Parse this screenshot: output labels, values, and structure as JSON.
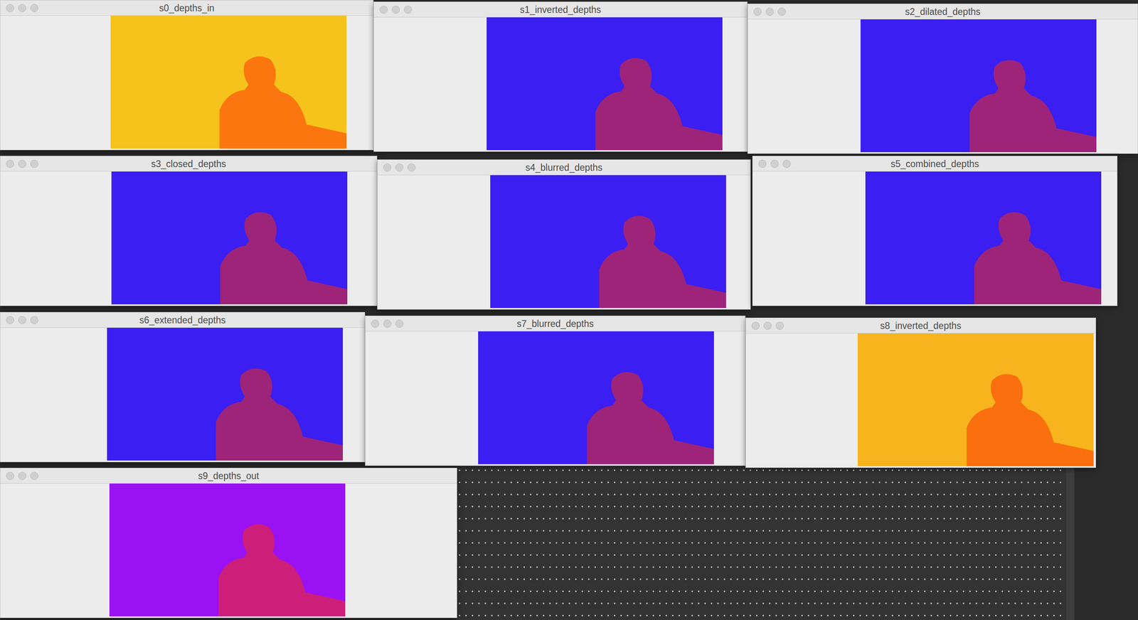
{
  "desktop": {
    "windows": [
      {
        "title": "s0_depths_in",
        "color": "#f6c21c"
      },
      {
        "title": "s1_inverted_depths",
        "color": "#3b1ef2"
      },
      {
        "title": "s2_dilated_depths",
        "color": "#3b1ef2"
      },
      {
        "title": "s3_closed_depths",
        "color": "#3b1ef2"
      },
      {
        "title": "s4_blurred_depths",
        "color": "#3b1ef2"
      },
      {
        "title": "s5_combined_depths",
        "color": "#3b1ef2"
      },
      {
        "title": "s6_extended_depths",
        "color": "#3b1ef2"
      },
      {
        "title": "s7_blurred_depths",
        "color": "#3b1ef2"
      },
      {
        "title": "s8_inverted_depths",
        "color": "#f7b41c"
      },
      {
        "title": "s9_depths_out",
        "color": "#9a12f4"
      }
    ]
  }
}
